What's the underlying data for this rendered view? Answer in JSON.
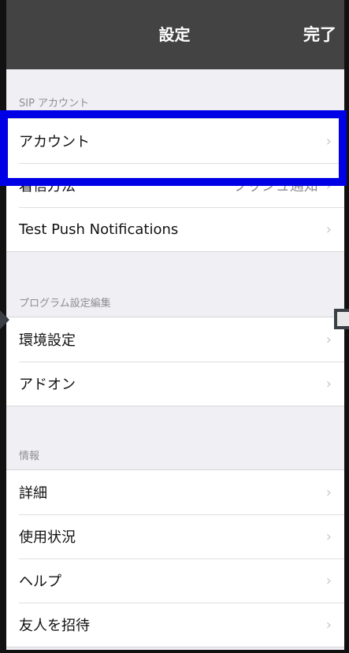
{
  "navbar": {
    "title": "設定",
    "done_label": "完了"
  },
  "sections": [
    {
      "header": "SIP アカウント",
      "rows": [
        {
          "label": "アカウント",
          "value": ""
        },
        {
          "label": "着信方法",
          "value": "プッシュ通知"
        },
        {
          "label": "Test Push Notifications",
          "value": ""
        }
      ]
    },
    {
      "header": "プログラム設定編集",
      "rows": [
        {
          "label": "環境設定",
          "value": ""
        },
        {
          "label": "アドオン",
          "value": ""
        }
      ]
    },
    {
      "header": "情報",
      "rows": [
        {
          "label": "詳細",
          "value": ""
        },
        {
          "label": "使用状況",
          "value": ""
        },
        {
          "label": "ヘルプ",
          "value": ""
        },
        {
          "label": "友人を招待",
          "value": ""
        }
      ]
    }
  ],
  "chevron_glyph": "›",
  "colors": {
    "navbar_bg": "#434343",
    "highlight_border": "#0000e6",
    "background": "#efeff4"
  }
}
